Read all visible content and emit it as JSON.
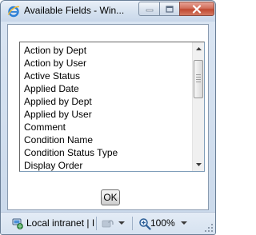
{
  "window": {
    "title": "Available Fields - Win...",
    "title_icon": "internet-explorer-icon",
    "controls": {
      "minimize_icon": "minimize-icon",
      "maximize_icon": "maximize-icon",
      "close_icon": "close-icon"
    }
  },
  "list": {
    "items": [
      "Action by Dept",
      "Action by User",
      "Active Status",
      "Applied Date",
      "Applied by Dept",
      "Applied by User",
      "Comment",
      "Condition Name",
      "Condition Status Type",
      "Display Order"
    ]
  },
  "ok_button": {
    "label": "OK"
  },
  "statusbar": {
    "zone_text": "Local intranet | I",
    "zone_icon": "local-intranet-icon",
    "protected_mode_icon": "protected-mode-icon",
    "zoom_icon": "zoom-icon",
    "zoom_text": "100%"
  },
  "colors": {
    "frame": "#c9d8ea",
    "close_button": "#c04a31",
    "list_border": "#7f9db9"
  }
}
